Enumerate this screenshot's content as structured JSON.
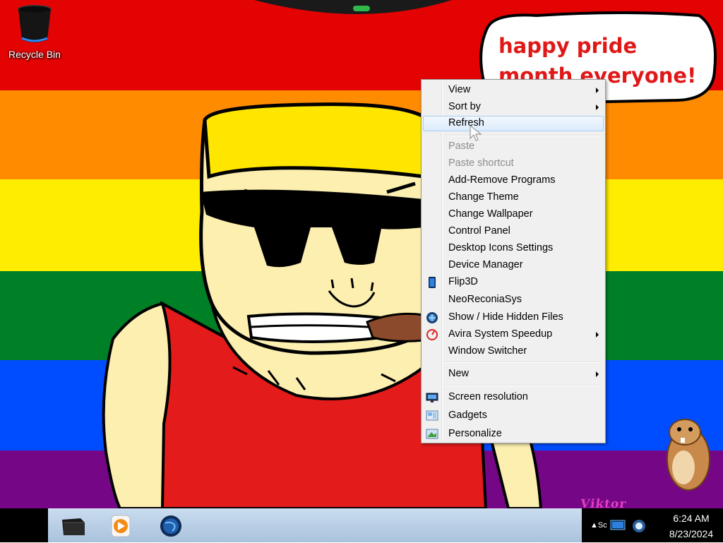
{
  "wallpaper": {
    "speech_text": "happy pride month everyone!",
    "signature": "Viktor",
    "stripe_colors": [
      "#e40303",
      "#ff8c00",
      "#ffed00",
      "#008026",
      "#004dff",
      "#750787"
    ]
  },
  "desktop": {
    "icons": [
      {
        "label": "Recycle Bin",
        "icon": "recycle-bin-icon"
      }
    ]
  },
  "context_menu": {
    "items": [
      {
        "label": "View",
        "submenu": true
      },
      {
        "label": "Sort by",
        "submenu": true
      },
      {
        "label": "Refresh",
        "highlighted": true
      },
      {
        "label": "Paste",
        "disabled": true
      },
      {
        "label": "Paste shortcut",
        "disabled": true
      },
      {
        "label": "Add-Remove Programs"
      },
      {
        "label": "Change Theme"
      },
      {
        "label": "Change Wallpaper"
      },
      {
        "label": "Control Panel"
      },
      {
        "label": "Desktop Icons Settings"
      },
      {
        "label": "Device Manager"
      },
      {
        "label": "Flip3D",
        "icon": "flip3d-icon"
      },
      {
        "label": "NeoReconiaSys"
      },
      {
        "label": "Show / Hide Hidden Files",
        "icon": "globe-icon"
      },
      {
        "label": "Avira System Speedup",
        "icon": "avira-icon",
        "submenu": true
      },
      {
        "label": "Window Switcher"
      },
      {
        "label": "New",
        "submenu": true
      },
      {
        "label": "Screen resolution",
        "icon": "monitor-icon"
      },
      {
        "label": "Gadgets",
        "icon": "gadgets-icon"
      },
      {
        "label": "Personalize",
        "icon": "personalize-icon"
      }
    ]
  },
  "taskbar": {
    "pinned": [
      {
        "name": "file-explorer-icon"
      },
      {
        "name": "media-player-icon"
      },
      {
        "name": "internet-browser-icon"
      }
    ],
    "tray": {
      "overflow_label": "Sc",
      "time": "6:24 AM",
      "date": "8/23/2024"
    }
  }
}
